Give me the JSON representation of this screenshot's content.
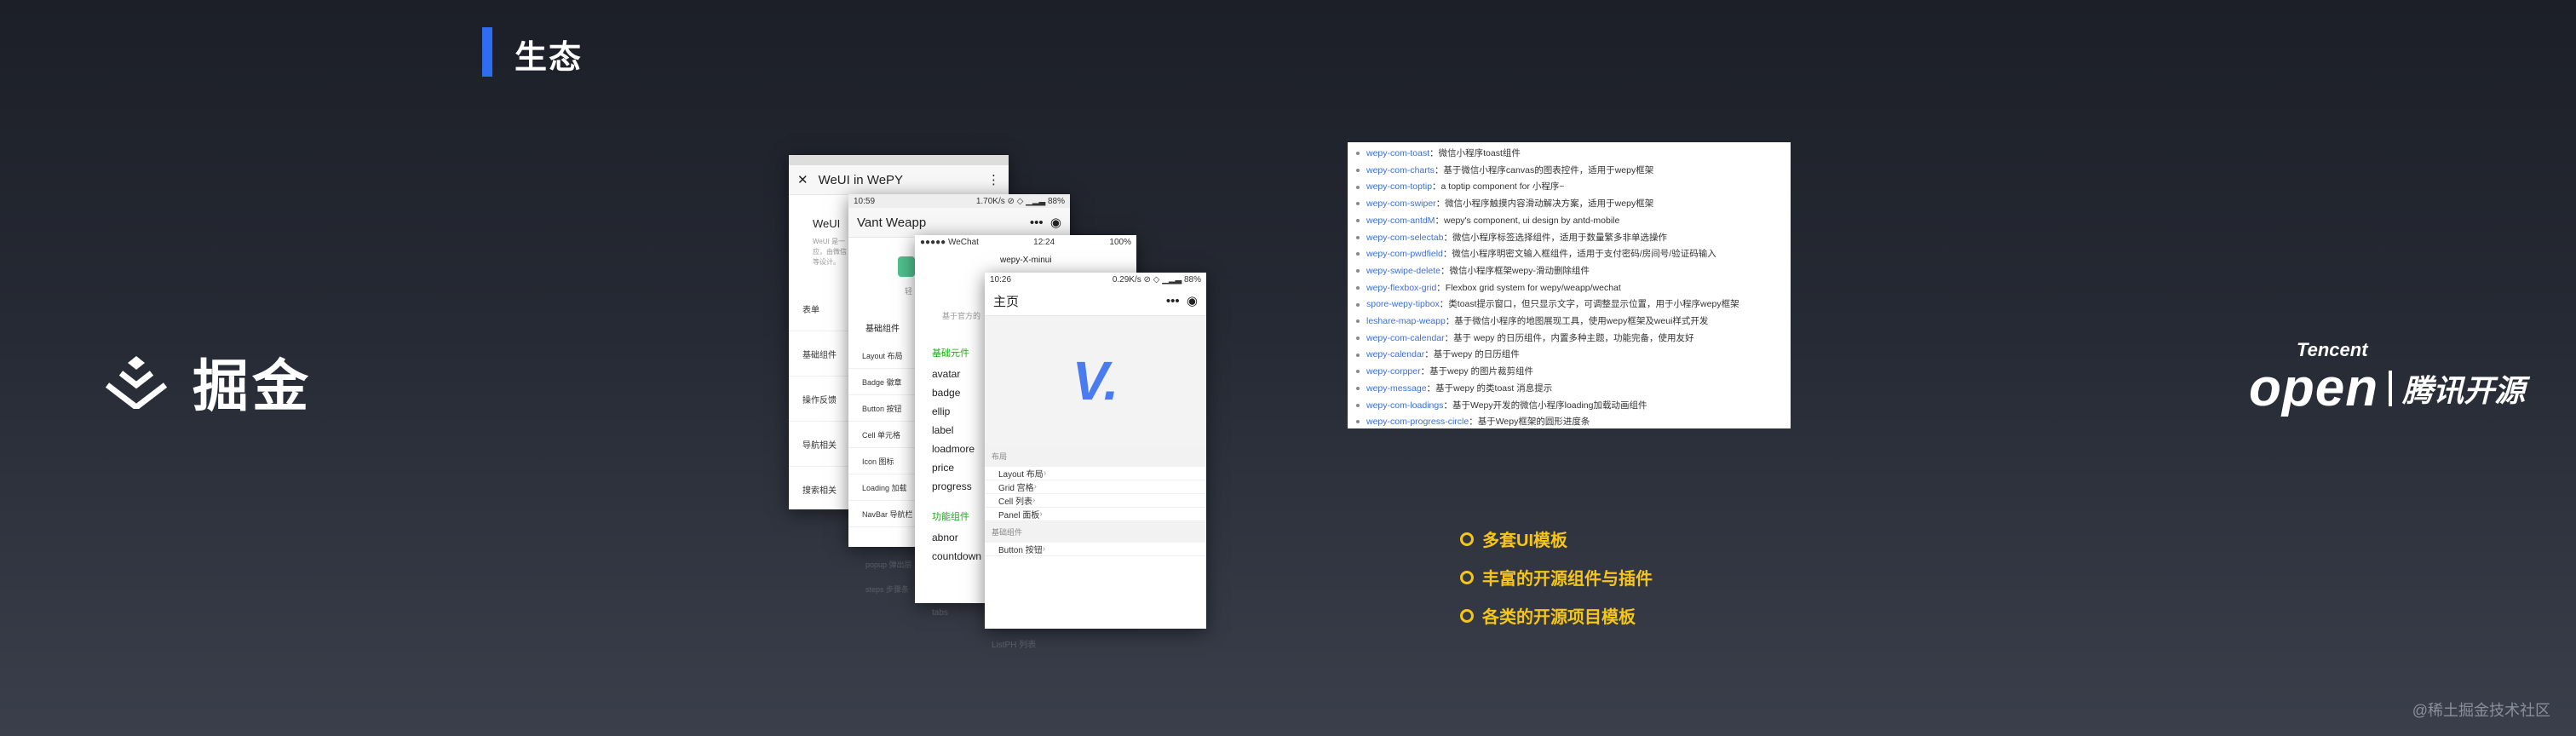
{
  "title": "生态",
  "juejin_logo": {
    "text": "掘金"
  },
  "tencent_logo": {
    "small": "Tencent",
    "big": "open",
    "cn": "腾讯开源"
  },
  "phone1": {
    "nav_title": "WeUI in WePY",
    "head": "WeUI",
    "desc1": "WeUI 是一",
    "desc2": "应，由微信",
    "desc3": "等设计。",
    "items": [
      "表单",
      "基础组件",
      "操作反馈",
      "导航相关",
      "搜索相关"
    ]
  },
  "phone2": {
    "status": "10:59 ",
    "status_r": "1.70K/s ⊘ ◇ ▁▂▃ 88%",
    "nav_title": "Vant Weapp",
    "sub": "轻",
    "section": "基础组件",
    "items": [
      "Layout 布局",
      "Badge 徽章",
      "Button 按钮",
      "Cell 单元格",
      "Icon 图标",
      "Loading 加载",
      "NavBar 导航栏"
    ],
    "reflect_items": [
      "popup 弹出层",
      "steps 步骤条"
    ]
  },
  "phone3": {
    "status_l": "●●●●● WeChat ",
    "status_c": "12:24",
    "status_r": "100%",
    "desc": "基于官方的",
    "section1": "基础元件",
    "items1": [
      "avatar",
      "badge",
      "ellip",
      "label",
      "loadmore",
      "price",
      "progress"
    ],
    "section2": "功能组件",
    "items2": [
      "abnor",
      "countdown"
    ],
    "reflect_items": [
      "tabs"
    ]
  },
  "phone4": {
    "top_title": "wepy-X-minui",
    "status_l": "10:26 ",
    "status_r": "0.29K/s ⊘ ◇ ▁▂▃ 88%",
    "nav_title": "主页",
    "logo": "V.",
    "section1": "布局",
    "items1": [
      "Layout 布局",
      "Grid 宫格",
      "Cell 列表",
      "Panel 面板"
    ],
    "section2": "基础组件",
    "items2": [
      "Button 按钮"
    ],
    "reflect_item": "ListPH 列表"
  },
  "code_lines": [
    {
      "name": "wepy-com-toast",
      "desc": "：微信小程序toast组件"
    },
    {
      "name": "wepy-com-charts",
      "desc": "：基于微信小程序canvas的图表控件，适用于wepy框架"
    },
    {
      "name": "wepy-com-toptip",
      "desc": "：a toptip component for 小程序~"
    },
    {
      "name": "wepy-com-swiper",
      "desc": "：微信小程序触摸内容滑动解决方案，适用于wepy框架"
    },
    {
      "name": "wepy-com-antdM",
      "desc": "：wepy's component, ui design by antd-mobile"
    },
    {
      "name": "wepy-com-selectab",
      "desc": "：微信小程序标签选择组件，适用于数量繁多非单选操作"
    },
    {
      "name": "wepy-com-pwdfield",
      "desc": "：微信小程序明密文输入框组件，适用于支付密码/房间号/验证码输入"
    },
    {
      "name": "wepy-swipe-delete",
      "desc": "：微信小程序框架wepy-滑动删除组件"
    },
    {
      "name": "wepy-flexbox-grid",
      "desc": "：Flexbox grid system for wepy/weapp/wechat"
    },
    {
      "name": "spore-wepy-tipbox",
      "desc": "：类toast提示窗口，但只显示文字，可调整显示位置，用于小程序wepy框架"
    },
    {
      "name": "leshare-map-weapp",
      "desc": "：基于微信小程序的地图展现工具，使用wepy框架及weui样式开发"
    },
    {
      "name": "wepy-com-calendar",
      "desc": "：基于 wepy 的日历组件，内置多种主题，功能完备，使用友好"
    },
    {
      "name": "wepy-calendar",
      "desc": "：基于wepy 的日历组件"
    },
    {
      "name": "wepy-corpper",
      "desc": "：基于wepy 的图片裁剪组件"
    },
    {
      "name": "wepy-message",
      "desc": "：基于wepy 的类toast 消息提示"
    },
    {
      "name": "wepy-com-loadings",
      "desc": "：基于Wepy开发的微信小程序loading加载动画组件"
    },
    {
      "name": "wepy-com-progress-circle",
      "desc": "：基于Wepy框架的圆形进度条"
    }
  ],
  "bullets": [
    "多套UI模板",
    "丰富的开源组件与插件",
    "各类的开源项目模板"
  ],
  "watermark": "@稀土掘金技术社区",
  "colors": {
    "title_accent": "#2f6df0",
    "bullet": "#f5c518",
    "link": "#3b6fd8",
    "vant_green": "#1aad19",
    "wepy_blue": "#4a7cf0"
  }
}
